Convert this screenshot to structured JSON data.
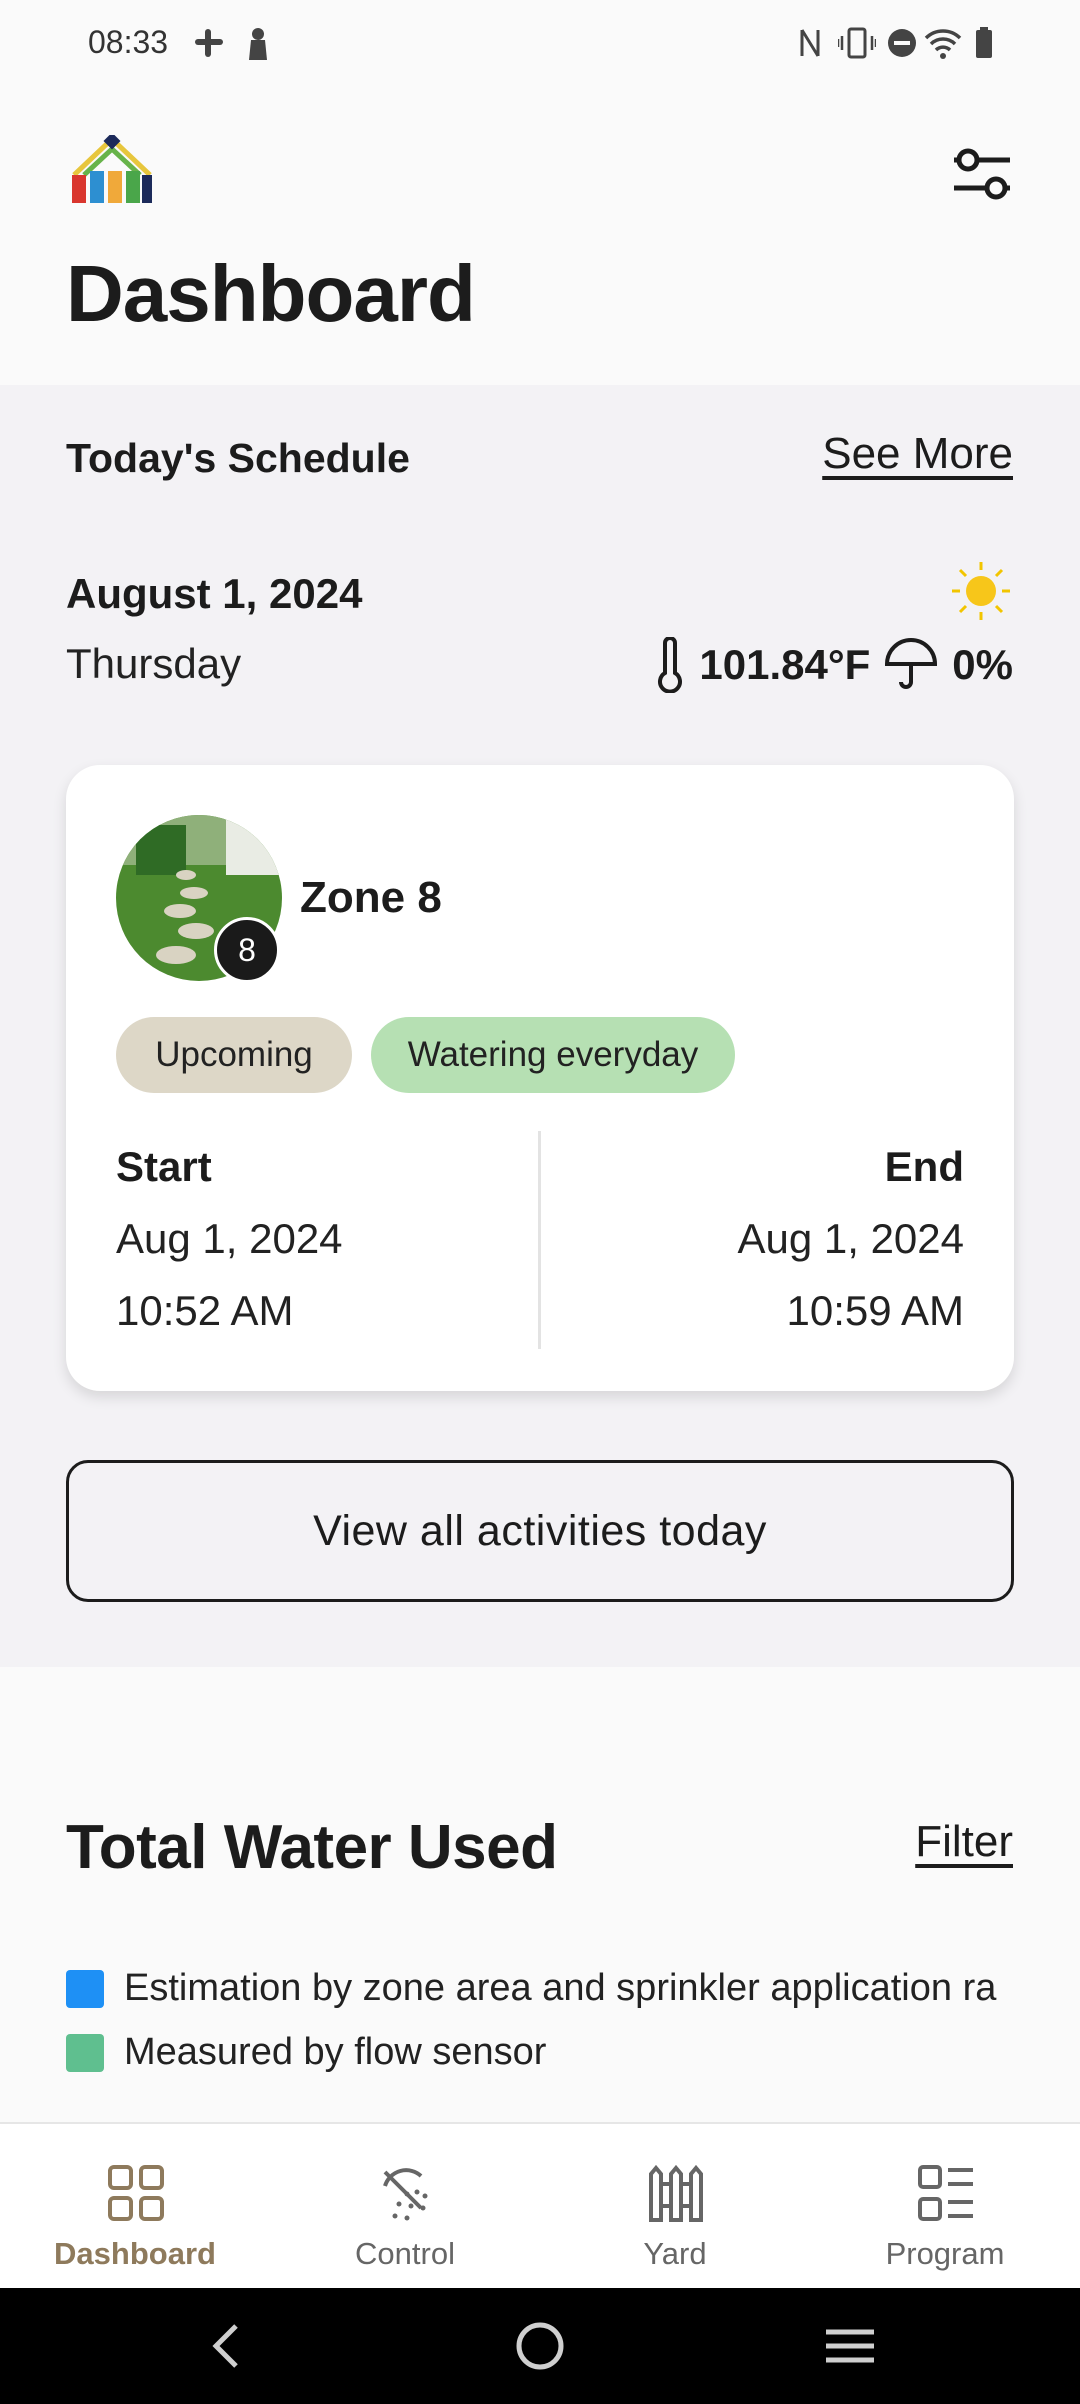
{
  "status_bar": {
    "time": "08:33",
    "icons": [
      "slack-icon",
      "notification-icon",
      "nfc-icon",
      "vibrate-icon",
      "dnd-icon",
      "wifi-icon",
      "battery-icon"
    ]
  },
  "header": {
    "title": "Dashboard",
    "logo": "home-brand-logo",
    "filter_icon": "sliders-icon"
  },
  "schedule": {
    "title": "Today's Schedule",
    "see_more": "See More",
    "date": "August 1, 2024",
    "weekday": "Thursday",
    "temperature": "101.84°F",
    "rain_chance": "0%",
    "weather_icon": "sun-icon",
    "zone": {
      "name": "Zone 8",
      "badge": "8",
      "status_chip": "Upcoming",
      "frequency_chip": "Watering everyday",
      "start_label": "Start",
      "start_date": "Aug 1, 2024",
      "start_time": "10:52 AM",
      "end_label": "End",
      "end_date": "Aug 1, 2024",
      "end_time": "10:59 AM"
    },
    "view_all": "View all activities today"
  },
  "water": {
    "title": "Total Water Used",
    "filter": "Filter",
    "legend": [
      {
        "label": "Estimation by zone area and sprinkler application ra",
        "color": "#1e90f5"
      },
      {
        "label": "Measured by flow sensor",
        "color": "#5fbf8f"
      }
    ]
  },
  "nav": {
    "items": [
      {
        "label": "Dashboard",
        "icon": "grid-icon",
        "active": true
      },
      {
        "label": "Control",
        "icon": "sprinkler-icon",
        "active": false
      },
      {
        "label": "Yard",
        "icon": "fence-icon",
        "active": false
      },
      {
        "label": "Program",
        "icon": "list-icon",
        "active": false
      }
    ]
  },
  "colors": {
    "accent": "#8e7a5c",
    "chip_upcoming": "#ddd7c7",
    "chip_watering": "#b6e0b3",
    "section_bg": "#f3f2f5"
  }
}
